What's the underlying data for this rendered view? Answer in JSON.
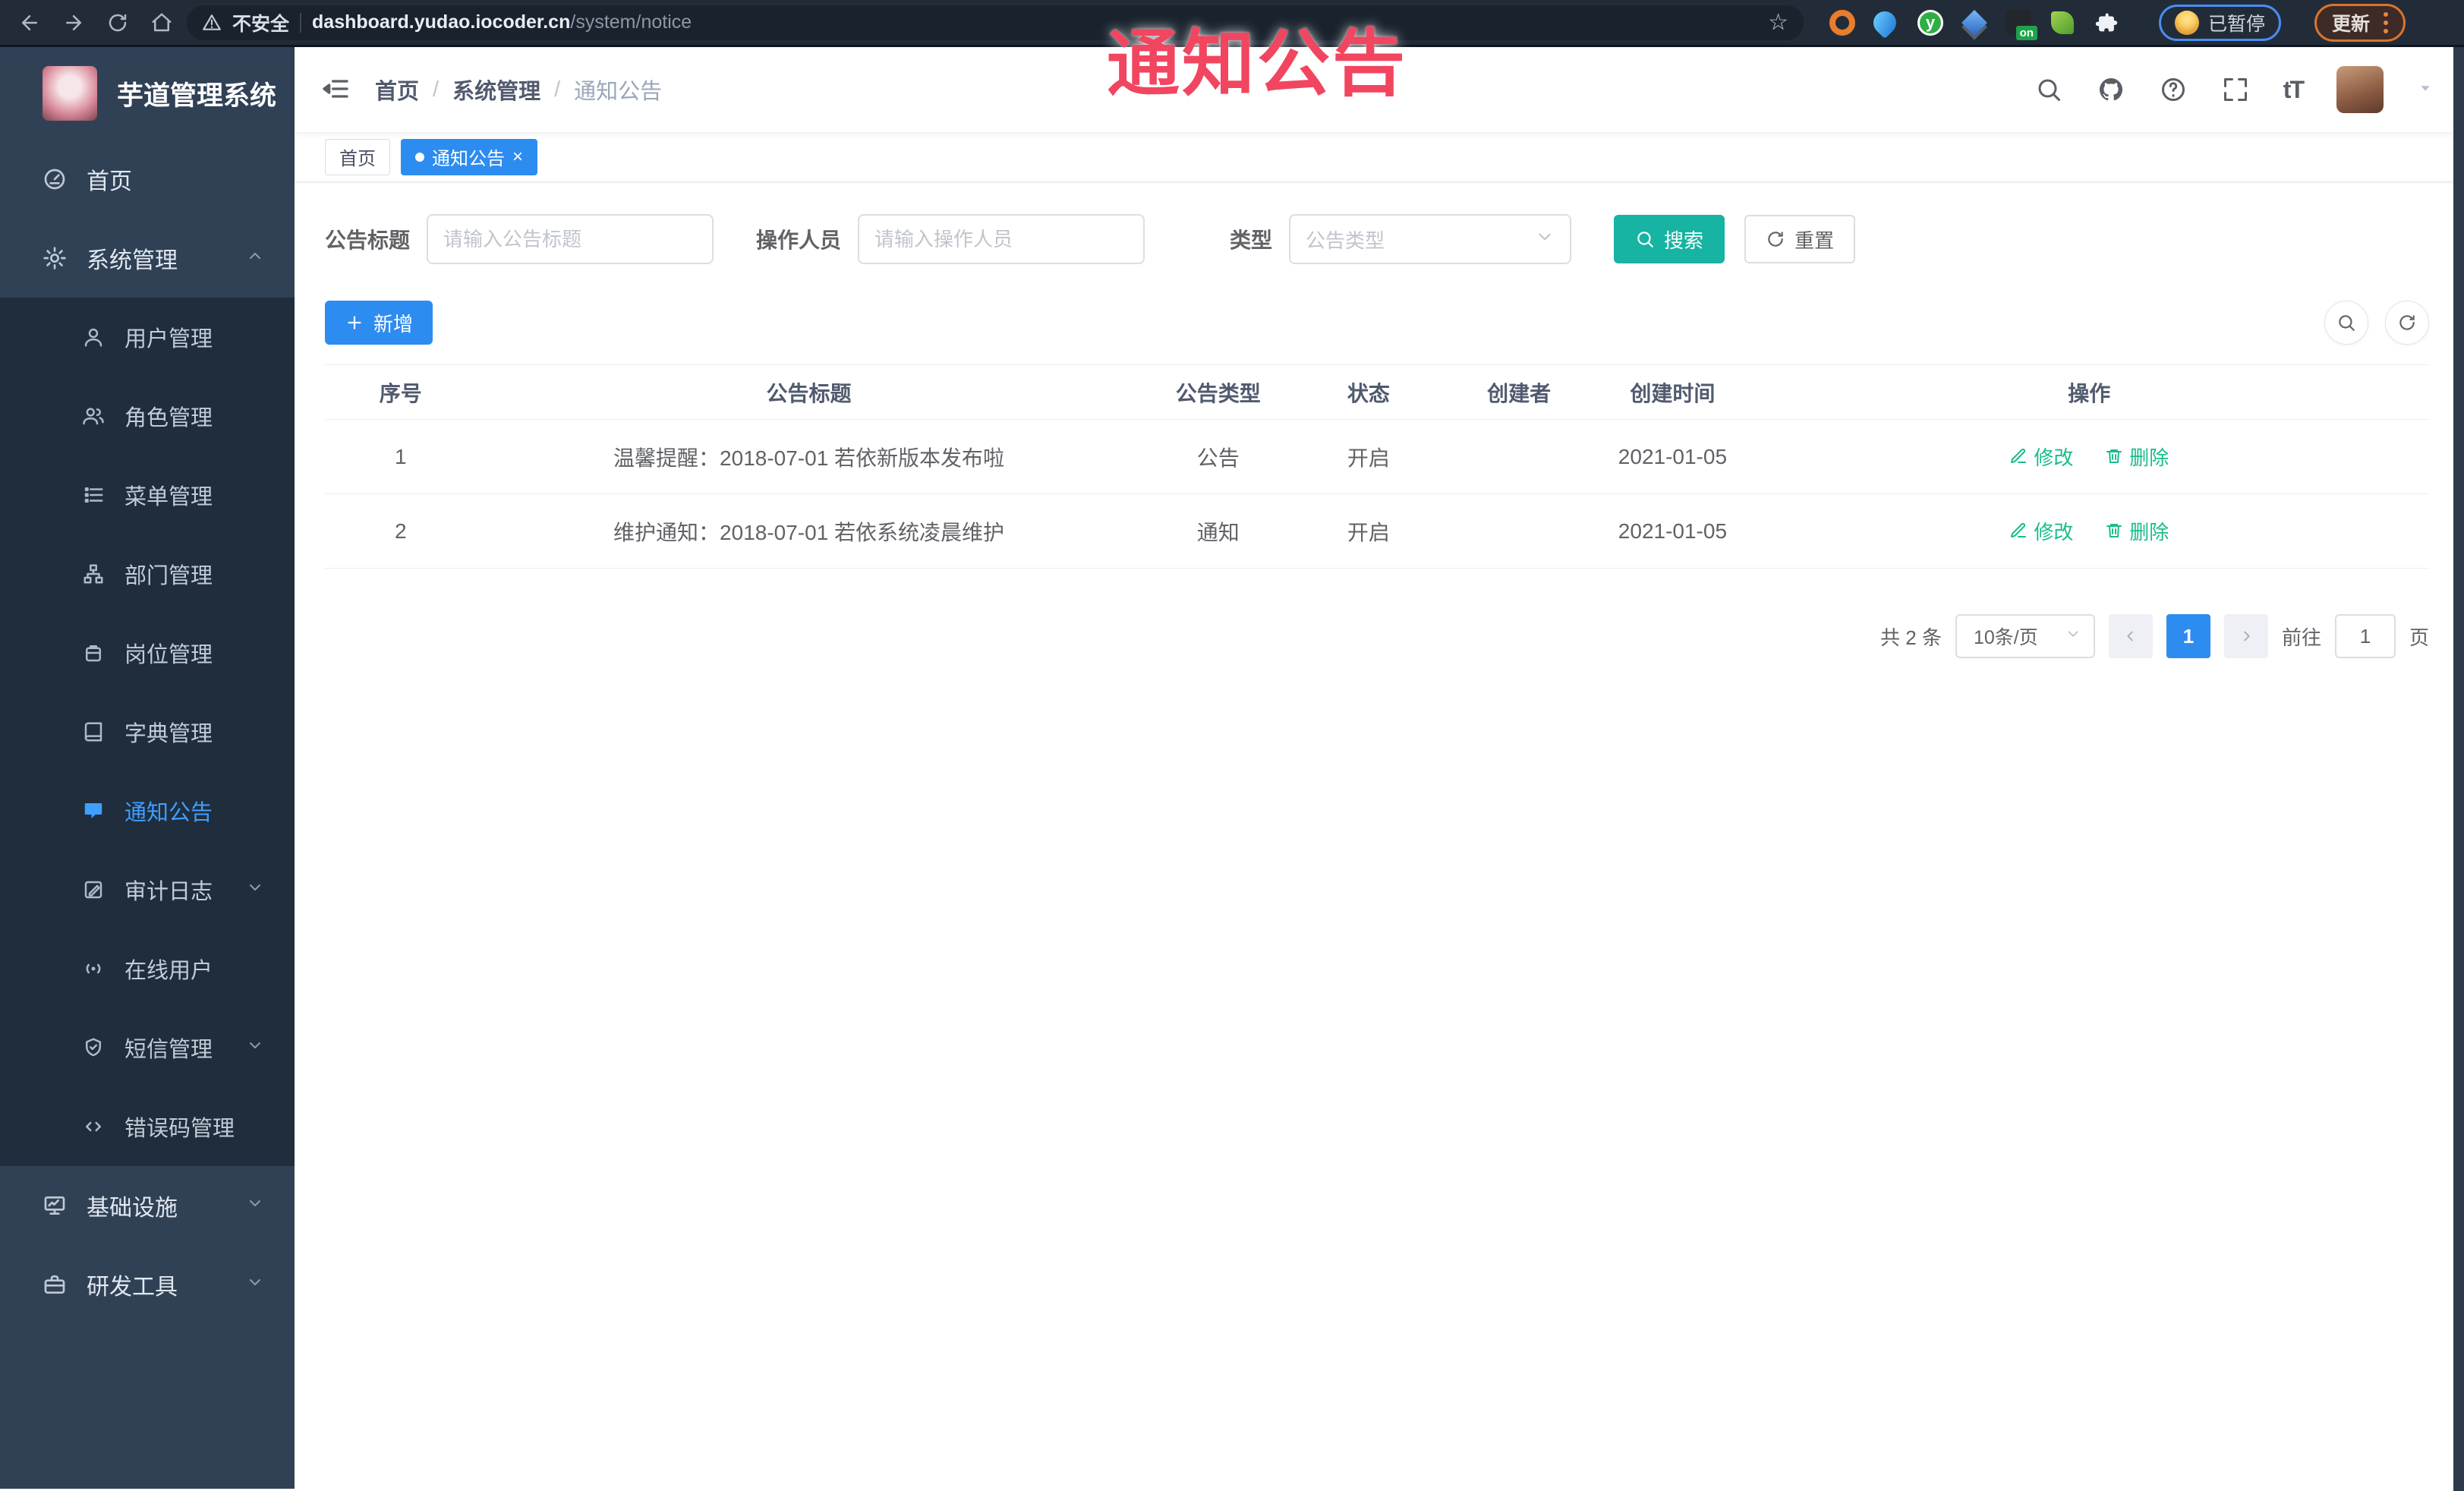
{
  "browser": {
    "security_label": "不安全",
    "url_host": "dashboard.yudao.iocoder.cn",
    "url_path": "/system/notice",
    "extension_badge": "on",
    "extension_letter": "y",
    "paused_label": "已暂停",
    "update_label": "更新"
  },
  "watermark": {
    "text": "通知公告"
  },
  "sidebar": {
    "title": "芋道管理系统",
    "home": "首页",
    "system": "系统管理",
    "sub": [
      "用户管理",
      "角色管理",
      "菜单管理",
      "部门管理",
      "岗位管理",
      "字典管理",
      "通知公告",
      "审计日志",
      "在线用户",
      "短信管理",
      "错误码管理"
    ],
    "infra": "基础设施",
    "devtools": "研发工具"
  },
  "breadcrumb": {
    "items": [
      "首页",
      "系统管理",
      "通知公告"
    ]
  },
  "tags": {
    "home": "首页",
    "active": "通知公告",
    "close": "×"
  },
  "filter": {
    "title_label": "公告标题",
    "title_placeholder": "请输入公告标题",
    "operator_label": "操作人员",
    "operator_placeholder": "请输入操作人员",
    "type_label": "类型",
    "type_placeholder": "公告类型",
    "search": "搜索",
    "reset": "重置"
  },
  "toolbar": {
    "add": "新增"
  },
  "table": {
    "headers": [
      "序号",
      "公告标题",
      "公告类型",
      "状态",
      "创建者",
      "创建时间",
      "操作"
    ],
    "rows": [
      {
        "no": "1",
        "title": "温馨提醒：2018-07-01 若依新版本发布啦",
        "type": "公告",
        "status": "开启",
        "creator": "",
        "created": "2021-01-05",
        "edit": "修改",
        "del": "删除"
      },
      {
        "no": "2",
        "title": "维护通知：2018-07-01 若依系统凌晨维护",
        "type": "通知",
        "status": "开启",
        "creator": "",
        "created": "2021-01-05",
        "edit": "修改",
        "del": "删除"
      }
    ]
  },
  "pagination": {
    "total": "共 2 条",
    "page_size": "10条/页",
    "current": "1",
    "goto_label": "前往",
    "goto_value": "1",
    "page_suffix": "页"
  }
}
